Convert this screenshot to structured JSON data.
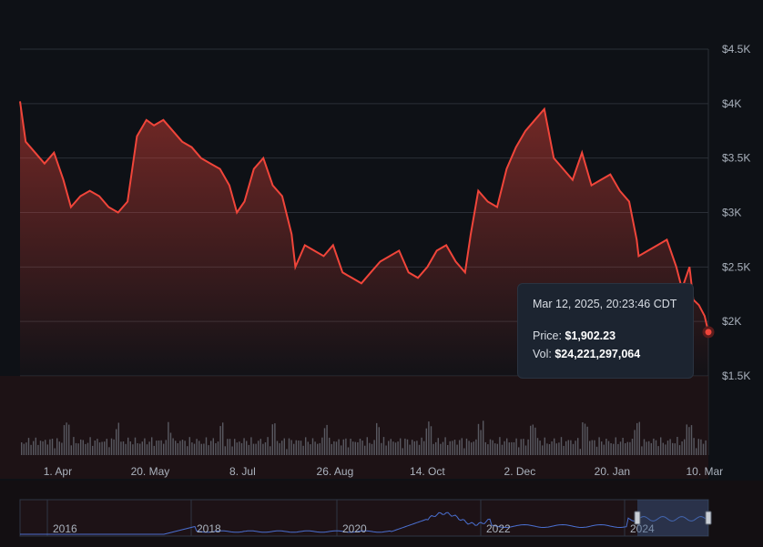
{
  "chart_data": {
    "type": "area",
    "series": [
      {
        "x": [
          "2024-03-12",
          "2024-03-15",
          "2024-03-20",
          "2024-03-25",
          "2024-03-30",
          "2024-04-04",
          "2024-04-08",
          "2024-04-13",
          "2024-04-18",
          "2024-04-23",
          "2024-04-28",
          "2024-05-03",
          "2024-05-08",
          "2024-05-13",
          "2024-05-18",
          "2024-05-22",
          "2024-05-27",
          "2024-06-01",
          "2024-06-06",
          "2024-06-11",
          "2024-06-16",
          "2024-06-21",
          "2024-06-26",
          "2024-07-01",
          "2024-07-05",
          "2024-07-09",
          "2024-07-14",
          "2024-07-19",
          "2024-07-24",
          "2024-07-29",
          "2024-08-03",
          "2024-08-05",
          "2024-08-10",
          "2024-08-15",
          "2024-08-20",
          "2024-08-25",
          "2024-08-30",
          "2024-09-04",
          "2024-09-09",
          "2024-09-14",
          "2024-09-19",
          "2024-09-24",
          "2024-09-29",
          "2024-10-04",
          "2024-10-09",
          "2024-10-14",
          "2024-10-19",
          "2024-10-24",
          "2024-10-29",
          "2024-11-03",
          "2024-11-06",
          "2024-11-10",
          "2024-11-15",
          "2024-11-20",
          "2024-11-25",
          "2024-11-30",
          "2024-12-05",
          "2024-12-10",
          "2024-12-15",
          "2024-12-20",
          "2024-12-25",
          "2024-12-30",
          "2025-01-04",
          "2025-01-09",
          "2025-01-14",
          "2025-01-19",
          "2025-01-24",
          "2025-01-29",
          "2025-02-02",
          "2025-02-03",
          "2025-02-08",
          "2025-02-13",
          "2025-02-18",
          "2025-02-23",
          "2025-02-26",
          "2025-03-02",
          "2025-03-04",
          "2025-03-07",
          "2025-03-10",
          "2025-03-12"
        ],
        "y": [
          4020,
          3650,
          3550,
          3450,
          3550,
          3300,
          3050,
          3150,
          3200,
          3150,
          3050,
          3000,
          3100,
          3700,
          3850,
          3800,
          3850,
          3750,
          3650,
          3600,
          3500,
          3450,
          3400,
          3250,
          3000,
          3100,
          3400,
          3500,
          3250,
          3150,
          2800,
          2500,
          2700,
          2650,
          2600,
          2700,
          2450,
          2400,
          2350,
          2450,
          2550,
          2600,
          2650,
          2450,
          2400,
          2500,
          2650,
          2700,
          2550,
          2450,
          2800,
          3200,
          3100,
          3050,
          3400,
          3600,
          3750,
          3850,
          3950,
          3500,
          3400,
          3300,
          3550,
          3250,
          3300,
          3350,
          3200,
          3100,
          2750,
          2600,
          2650,
          2700,
          2750,
          2500,
          2300,
          2500,
          2200,
          2150,
          2050,
          1902.23
        ]
      }
    ],
    "y_ticks": [
      "$4.5K",
      "$4K",
      "$3.5K",
      "$3K",
      "$2.5K",
      "$2K",
      "$1.5K"
    ],
    "ylim": [
      1500,
      4500
    ],
    "x_ticks": [
      {
        "label": "1. Apr",
        "date": "2024-04-01"
      },
      {
        "label": "20. May",
        "date": "2024-05-20"
      },
      {
        "label": "8. Jul",
        "date": "2024-07-08"
      },
      {
        "label": "26. Aug",
        "date": "2024-08-26"
      },
      {
        "label": "14. Oct",
        "date": "2024-10-14"
      },
      {
        "label": "2. Dec",
        "date": "2024-12-02"
      },
      {
        "label": "20. Jan",
        "date": "2025-01-20"
      },
      {
        "label": "10. Mar",
        "date": "2025-03-10"
      }
    ],
    "xlim": [
      "2024-03-12",
      "2025-03-12"
    ],
    "grid": true,
    "line_color": "#f0453a",
    "volume_color": "#8a94a0",
    "tooltip": {
      "date": "Mar 12, 2025, 20:23:46 CDT",
      "price_label": "Price:",
      "price_value": "$1,902.23",
      "vol_label": "Vol:",
      "vol_value": "$24,221,297,064"
    },
    "navigator": {
      "years": [
        "2016",
        "2018",
        "2020",
        "2022",
        "2024"
      ],
      "line_color": "#4a6fd0"
    }
  }
}
